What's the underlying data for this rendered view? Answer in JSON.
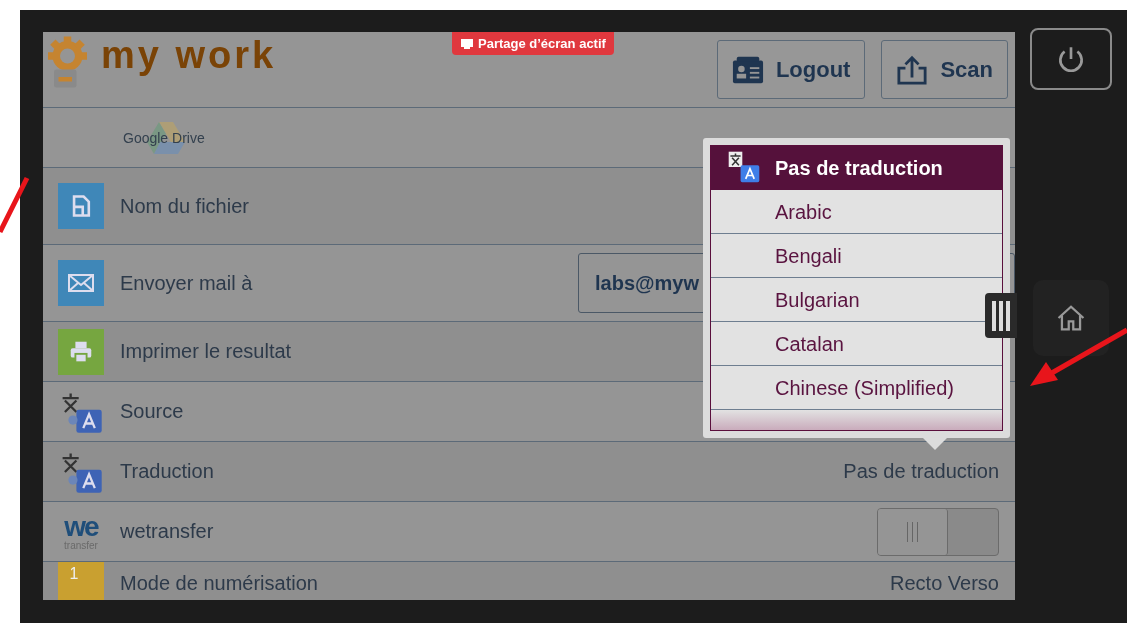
{
  "header": {
    "logo_text": "my work",
    "share_badge": "Partage d’écran actif",
    "buttons": [
      {
        "label": "Logout"
      },
      {
        "label": "Scan"
      }
    ]
  },
  "service": {
    "label": "Google Drive"
  },
  "settings": [
    {
      "kind": "plain",
      "label": "Nom du fichier"
    },
    {
      "kind": "input",
      "label": "Envoyer mail à",
      "value": "labs@myw"
    },
    {
      "kind": "plain",
      "label": "Imprimer le resultat"
    },
    {
      "kind": "plain",
      "label": "Source"
    },
    {
      "kind": "value",
      "label": "Traduction",
      "value": "Pas de traduction"
    },
    {
      "kind": "toggle",
      "icon_text": "we",
      "icon_subtext": "transfer",
      "label": "wetransfer",
      "on": false
    },
    {
      "kind": "value",
      "icon_text": "1",
      "label": "Mode de numérisation",
      "value": "Recto Verso"
    }
  ],
  "dropdown": {
    "options": [
      {
        "label": "Pas de traduction",
        "selected": true
      },
      {
        "label": "Arabic",
        "selected": false
      },
      {
        "label": "Bengali",
        "selected": false
      },
      {
        "label": "Bulgarian",
        "selected": false
      },
      {
        "label": "Catalan",
        "selected": false
      },
      {
        "label": "Chinese (Simplified)",
        "selected": false
      }
    ]
  }
}
